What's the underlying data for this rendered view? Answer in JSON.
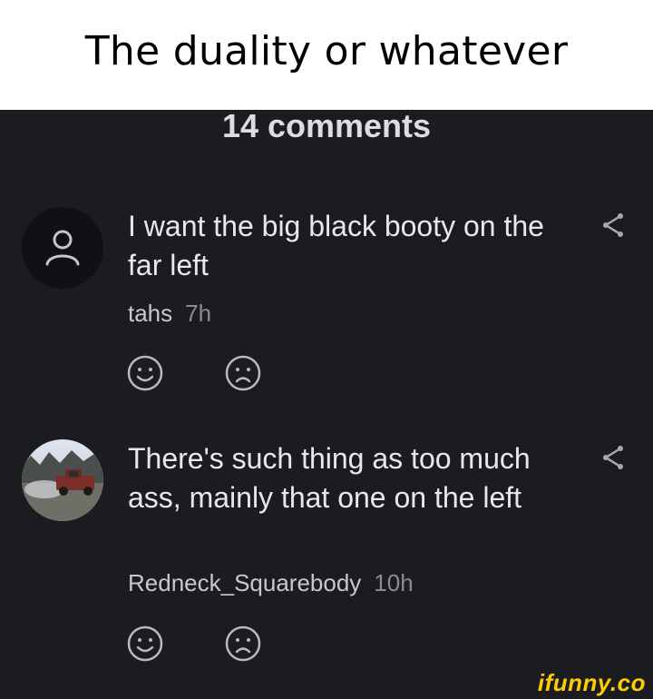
{
  "meme": {
    "title": "The duality or whatever"
  },
  "thread": {
    "comments_count": "14 comments"
  },
  "comments": [
    {
      "text": "I want the big black booty on the far left",
      "author": "tahs",
      "time": "7h",
      "avatar": "default-user-icon"
    },
    {
      "text": "There's such thing as too much ass, mainly that one on the left",
      "author": "Redneck_Squarebody",
      "time": "10h",
      "avatar": "truck-photo"
    }
  ],
  "watermark": "ifunny.co",
  "colors": {
    "background": "#1b1c20",
    "text": "#e7e8ea",
    "muted": "#8b8c91",
    "brand": "#ffcc00"
  }
}
